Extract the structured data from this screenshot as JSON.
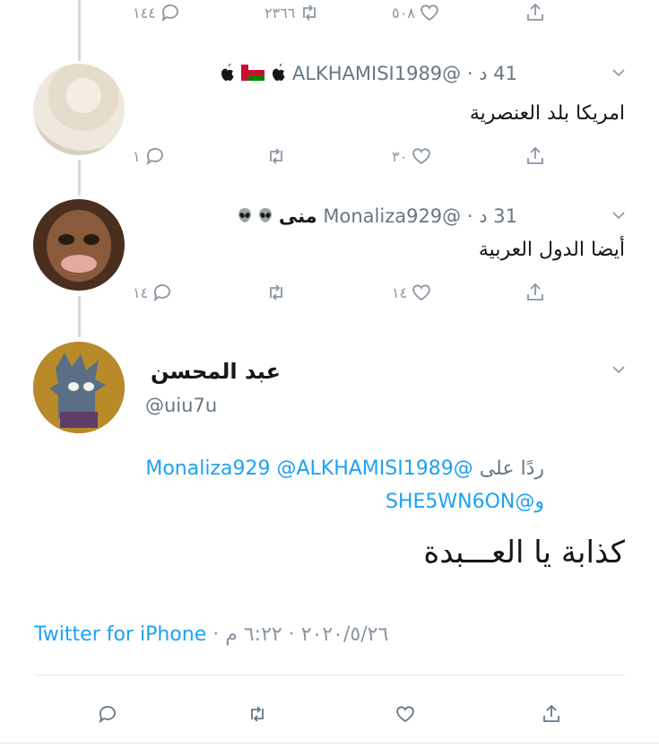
{
  "top_actions": {
    "replies": "١٤٤",
    "retweets": "٢٣٦٦",
    "likes": "٥٠٨"
  },
  "tweets": [
    {
      "time": "41 د",
      "handle": "@ALKHAMISI1989",
      "name": "",
      "text": "امريكا بلد العنصرية",
      "replies": "١",
      "retweets": "",
      "likes": "٣٠"
    },
    {
      "time": "31 د",
      "handle": "@Monaliza929",
      "name": "منى",
      "text": "أيضا الدول العربية",
      "replies": "١٤",
      "retweets": "",
      "likes": "١٤"
    }
  ],
  "main_tweet": {
    "name": "عبد المحسن",
    "handle": "@uiu7u",
    "reply_prefix": "ردًا على",
    "reply_mentions": [
      "@Monaliza929",
      "@ALKHAMISI1989"
    ],
    "reply_conj": "و",
    "reply_mention_last": "@SHE5WN6ON",
    "text": "كذابة يا العـــبدة",
    "time": "٦:٢٢ م",
    "date": "٢٠٢٠/٥/٢٦",
    "source": "Twitter for iPhone"
  },
  "colors": {
    "link": "#1da1f2",
    "muted": "#8a96a3",
    "line": "#cfd9de"
  }
}
